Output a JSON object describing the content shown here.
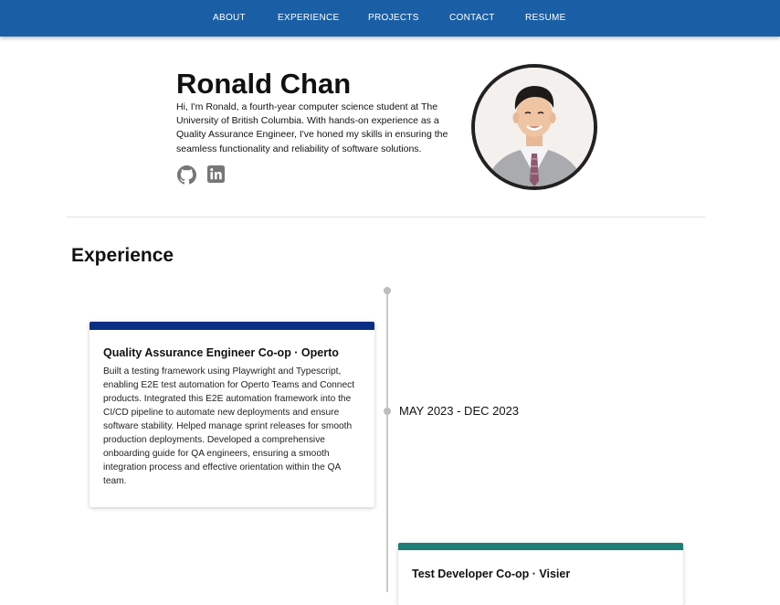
{
  "nav": {
    "items": [
      "ABOUT",
      "EXPERIENCE",
      "PROJECTS",
      "CONTACT",
      "RESUME"
    ]
  },
  "hero": {
    "name": "Ronald Chan",
    "bio": "Hi, I'm Ronald, a fourth-year computer science student at The University of British Columbia. With hands-on experience as a Quality Assurance Engineer, I've honed my skills in ensuring the seamless functionality and reliability of software solutions.",
    "social_icons": [
      "github-icon",
      "linkedin-icon"
    ]
  },
  "experience": {
    "section_title": "Experience",
    "items": [
      {
        "title": "Quality Assurance Engineer Co-op · Operto",
        "description": "Built a testing framework using Playwright and Typescript, enabling E2E test automation for Operto Teams and Connect products. Integrated this E2E automation framework into the CI/CD pipeline to automate new deployments and ensure software stability. Helped manage sprint releases for smooth production deployments. Developed a comprehensive onboarding guide for QA engineers, ensuring a smooth integration process and effective orientation within the QA team.",
        "date": "MAY 2023 - DEC 2023",
        "accent": "#0b2f85"
      },
      {
        "title": "Test Developer Co-op · Visier",
        "accent": "#1e7d74"
      }
    ]
  },
  "colors": {
    "navbar": "#1a5fa5",
    "timeline": "#c9c9c9"
  }
}
